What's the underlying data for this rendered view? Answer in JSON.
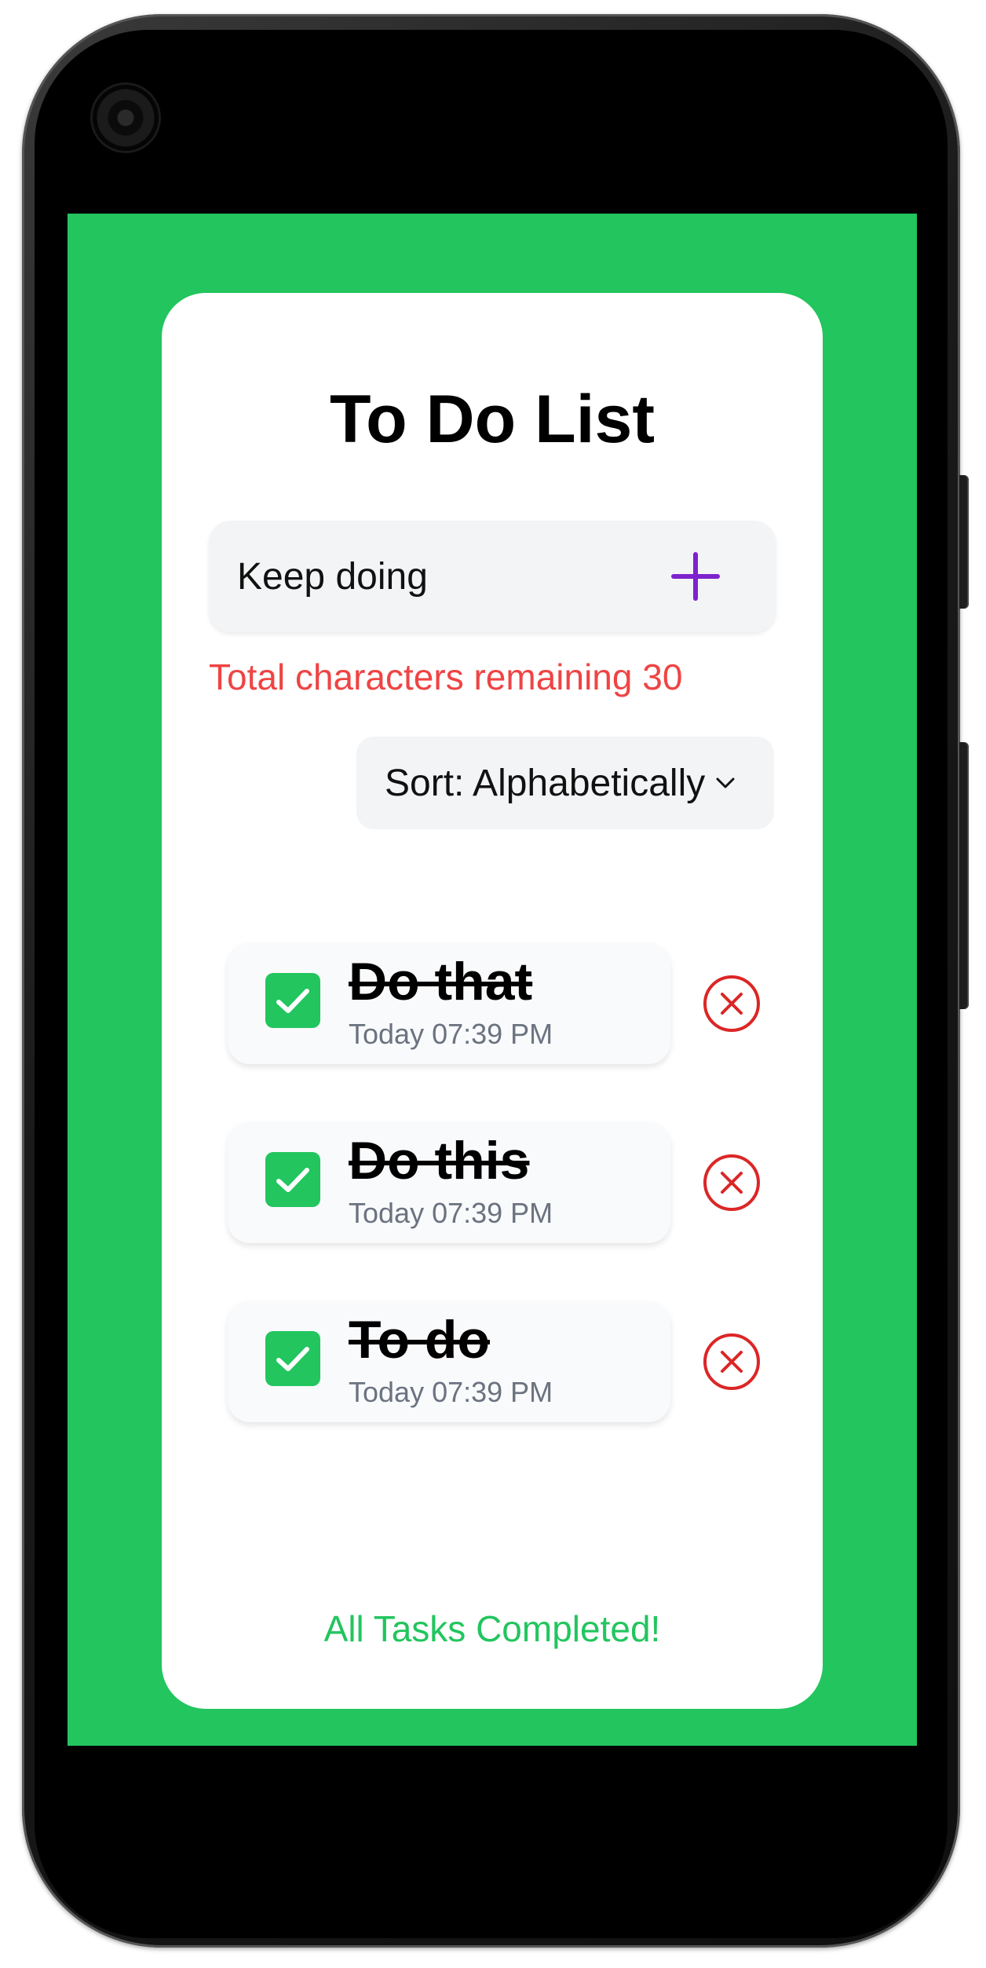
{
  "app": {
    "title": "To Do List",
    "colors": {
      "background": "#22c55e",
      "card": "#ffffff",
      "accent": "#7e22ce",
      "error": "#ef4444",
      "delete": "#dc2626",
      "success": "#22c55e",
      "muted": "#6b7280"
    }
  },
  "input": {
    "value": "Keep doing",
    "add_icon": "plus-icon"
  },
  "validation": {
    "char_remaining": "Total characters remaining 30"
  },
  "sort": {
    "selected": "Sort: Alphabetically",
    "icon": "chevron-down-icon"
  },
  "tasks": [
    {
      "text": "Do that",
      "time": "Today 07:39 PM",
      "completed": true
    },
    {
      "text": "Do this",
      "time": "Today 07:39 PM",
      "completed": true
    },
    {
      "text": "To do",
      "time": "Today 07:39 PM",
      "completed": true
    }
  ],
  "status": "All Tasks Completed!"
}
